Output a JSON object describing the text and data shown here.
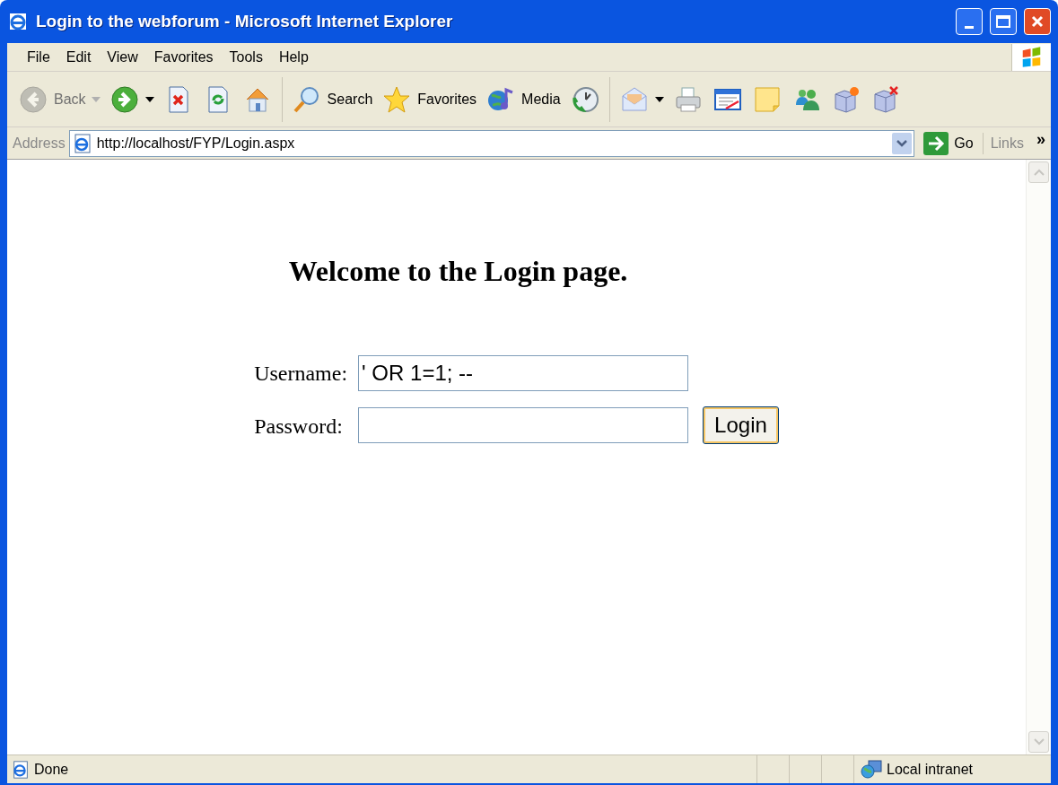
{
  "window": {
    "title": "Login to the webforum - Microsoft Internet Explorer"
  },
  "menu": [
    "File",
    "Edit",
    "View",
    "Favorites",
    "Tools",
    "Help"
  ],
  "toolbar": [
    {
      "label": "Back",
      "disabled": true,
      "dropdown": true
    },
    {
      "disabled": false,
      "dropdown": true
    },
    {
      "disabled": false,
      "dropdown": false
    },
    {
      "disabled": false,
      "dropdown": false
    },
    {
      "disabled": false,
      "dropdown": false
    },
    {
      "label": "Search",
      "disabled": false,
      "dropdown": false
    },
    {
      "label": "Favorites",
      "disabled": false,
      "dropdown": false
    },
    {
      "label": "Media",
      "disabled": false,
      "dropdown": false
    },
    {
      "disabled": false,
      "dropdown": false
    },
    {
      "disabled": false,
      "dropdown": true
    },
    {
      "disabled": false,
      "dropdown": false
    },
    {
      "disabled": false,
      "dropdown": false
    },
    {
      "disabled": false,
      "dropdown": false
    },
    {
      "disabled": false,
      "dropdown": false
    },
    {
      "disabled": false,
      "dropdown": false
    },
    {
      "disabled": false,
      "dropdown": false
    }
  ],
  "address_bar": {
    "label": "Address",
    "url": "http://localhost/FYP/Login.aspx",
    "go": "Go",
    "links": "Links",
    "more": "»"
  },
  "page": {
    "heading": "Welcome to the Login page.",
    "fields": [
      {
        "label": "Username:",
        "value": "' OR 1=1; --"
      },
      {
        "label": "Password:"
      }
    ],
    "button": "Login"
  },
  "status_bar": {
    "text": "Done",
    "zone": "Local intranet"
  }
}
